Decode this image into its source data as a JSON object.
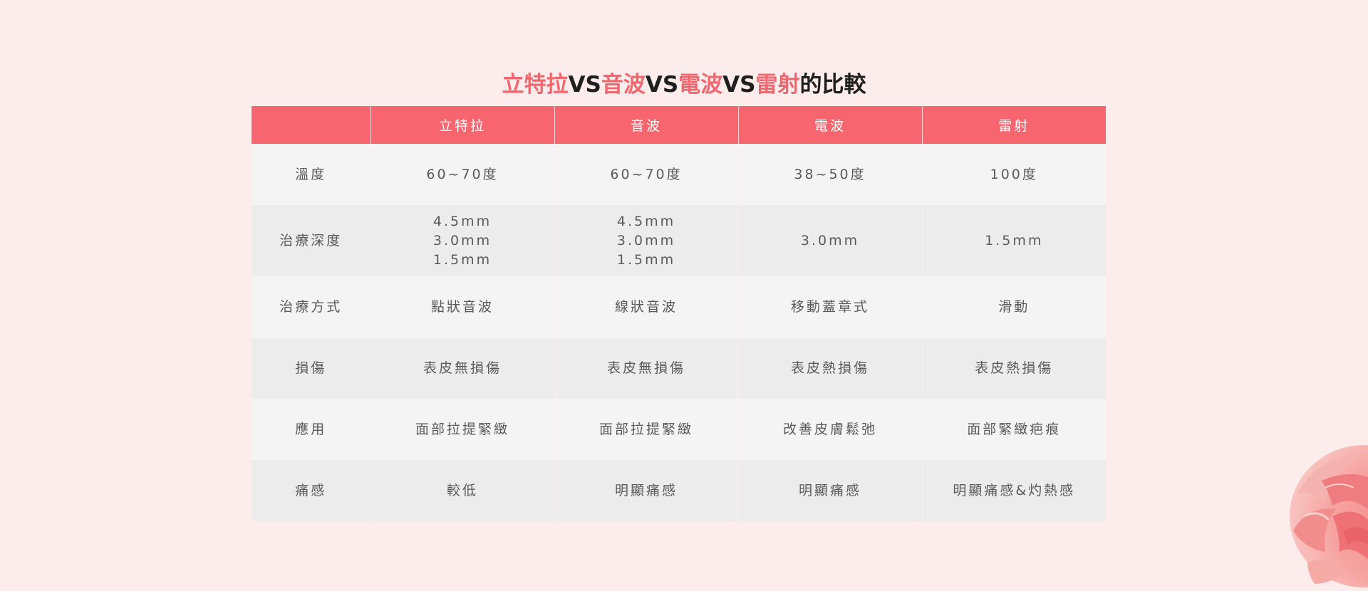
{
  "title": {
    "parts": [
      "立特拉",
      "VS",
      "音波",
      "VS",
      "電波",
      "VS",
      "雷射",
      "的比較"
    ]
  },
  "table": {
    "headers": [
      "",
      "立特拉",
      "音波",
      "電波",
      "雷射"
    ],
    "rows": [
      {
        "label": "溫度",
        "cells": [
          [
            "60~70度"
          ],
          [
            "60~70度"
          ],
          [
            "38~50度"
          ],
          [
            "100度"
          ]
        ]
      },
      {
        "label": "治療深度",
        "cells": [
          [
            "4.5mm",
            "3.0mm",
            "1.5mm"
          ],
          [
            "4.5mm",
            "3.0mm",
            "1.5mm"
          ],
          [
            "3.0mm"
          ],
          [
            "1.5mm"
          ]
        ]
      },
      {
        "label": "治療方式",
        "cells": [
          [
            "點狀音波"
          ],
          [
            "線狀音波"
          ],
          [
            "移動蓋章式"
          ],
          [
            "滑動"
          ]
        ]
      },
      {
        "label": "損傷",
        "cells": [
          [
            "表皮無損傷"
          ],
          [
            "表皮無損傷"
          ],
          [
            "表皮熱損傷"
          ],
          [
            "表皮熱損傷"
          ]
        ]
      },
      {
        "label": "應用",
        "cells": [
          [
            "面部拉提緊緻"
          ],
          [
            "面部拉提緊緻"
          ],
          [
            "改善皮膚鬆弛"
          ],
          [
            "面部緊緻疤痕"
          ]
        ]
      },
      {
        "label": "痛感",
        "cells": [
          [
            "較低"
          ],
          [
            "明顯痛感"
          ],
          [
            "明顯痛感"
          ],
          [
            "明顯痛感&灼熱感"
          ]
        ]
      }
    ]
  },
  "colors": {
    "accent": "#f7666f",
    "background": "#fdecec",
    "row_light": "#f4f4f4",
    "row_dark": "#ececec",
    "text": "#5a5a5a"
  },
  "decor": {
    "icon": "rose-flower-icon"
  }
}
